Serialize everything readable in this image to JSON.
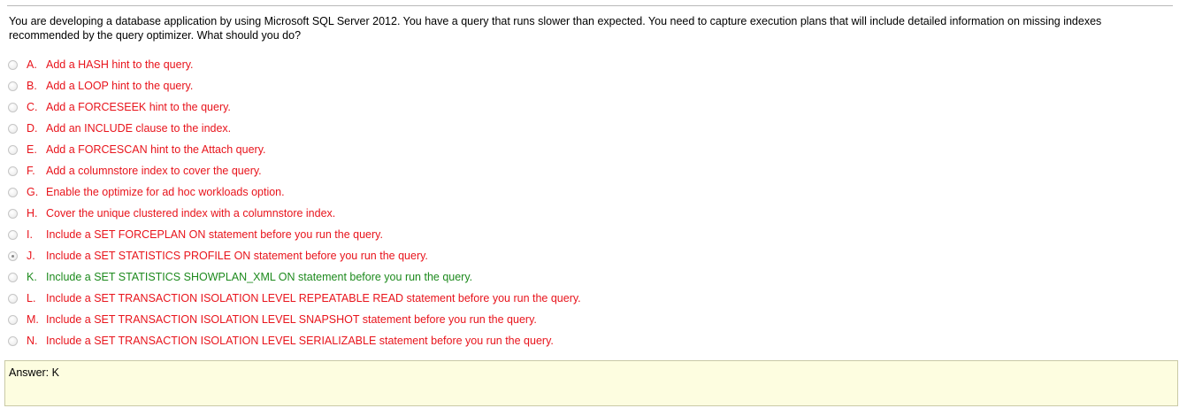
{
  "colors": {
    "incorrect": "#e8141c",
    "correct": "#1d8a1d",
    "answer_bg": "#fdfde0"
  },
  "question": {
    "text": "You are developing a database application by using Microsoft SQL Server 2012. You have a query that runs slower than expected. You need to capture execution plans that will include detailed information on missing indexes recommended by the query optimizer. What should you do?"
  },
  "options": [
    {
      "letter": "A.",
      "text": "Add a HASH hint to the query.",
      "status": "incorrect",
      "selected": false
    },
    {
      "letter": "B.",
      "text": "Add a LOOP hint to the query.",
      "status": "incorrect",
      "selected": false
    },
    {
      "letter": "C.",
      "text": "Add a FORCESEEK hint to the query.",
      "status": "incorrect",
      "selected": false
    },
    {
      "letter": "D.",
      "text": "Add an INCLUDE clause to the index.",
      "status": "incorrect",
      "selected": false
    },
    {
      "letter": "E.",
      "text": "Add a FORCESCAN hint to the Attach query.",
      "status": "incorrect",
      "selected": false
    },
    {
      "letter": "F.",
      "text": "Add a columnstore index to cover the query.",
      "status": "incorrect",
      "selected": false
    },
    {
      "letter": "G.",
      "text": "Enable the optimize for ad hoc workloads option.",
      "status": "incorrect",
      "selected": false
    },
    {
      "letter": "H.",
      "text": "Cover the unique clustered index with a columnstore index.",
      "status": "incorrect",
      "selected": false
    },
    {
      "letter": "I.",
      "text": "Include a SET FORCEPLAN ON statement before you run the query.",
      "status": "incorrect",
      "selected": false
    },
    {
      "letter": "J.",
      "text": "Include a SET STATISTICS PROFILE ON statement before you run the query.",
      "status": "incorrect",
      "selected": true
    },
    {
      "letter": "K.",
      "text": "Include a SET STATISTICS SHOWPLAN_XML ON statement before you run the query.",
      "status": "correct",
      "selected": false
    },
    {
      "letter": "L.",
      "text": "Include a SET TRANSACTION ISOLATION LEVEL REPEATABLE READ statement before you run the query.",
      "status": "incorrect",
      "selected": false
    },
    {
      "letter": "M.",
      "text": "Include a SET TRANSACTION ISOLATION LEVEL SNAPSHOT statement before you run the query.",
      "status": "incorrect",
      "selected": false
    },
    {
      "letter": "N.",
      "text": "Include a SET TRANSACTION ISOLATION LEVEL SERIALIZABLE statement before you run the query.",
      "status": "incorrect",
      "selected": false
    }
  ],
  "answer": {
    "text": "Answer: K"
  }
}
